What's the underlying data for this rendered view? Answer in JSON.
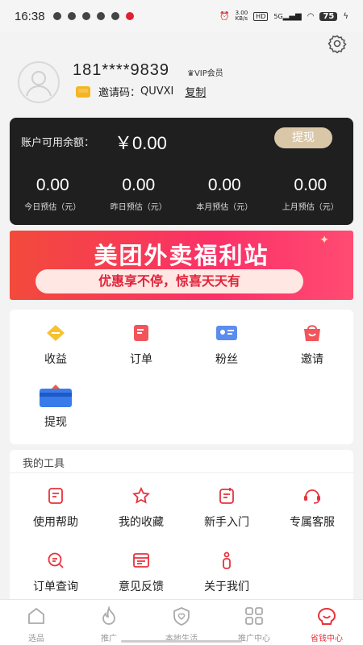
{
  "status_bar": {
    "time": "16:38",
    "net_speed_value": "3.00",
    "net_speed_unit": "KB/s",
    "hd": "HD",
    "sig": "5G",
    "battery": "75"
  },
  "profile": {
    "phone": "181****9839",
    "vip_label": "VIP会员",
    "invite_label": "邀请码：",
    "invite_code": "QUVXI",
    "copy_label": "复制"
  },
  "balance": {
    "label": "账户可用余额：",
    "amount": "￥0.00",
    "withdraw_label": "提现",
    "stats": [
      {
        "value": "0.00",
        "label": "今日预估（元）"
      },
      {
        "value": "0.00",
        "label": "昨日预估（元）"
      },
      {
        "value": "0.00",
        "label": "本月预估（元）"
      },
      {
        "value": "0.00",
        "label": "上月预估（元）"
      }
    ]
  },
  "banner": {
    "title": "美团外卖福利站",
    "subtitle": "优惠享不停，惊喜天天有"
  },
  "grid": [
    {
      "label": "收益",
      "icon": "earnings-icon"
    },
    {
      "label": "订单",
      "icon": "order-icon"
    },
    {
      "label": "粉丝",
      "icon": "fans-icon"
    },
    {
      "label": "邀请",
      "icon": "invite-icon"
    },
    {
      "label": "提现",
      "icon": "withdraw-icon"
    }
  ],
  "tools": {
    "title": "我的工具",
    "items": [
      {
        "label": "使用帮助",
        "icon": "help-icon"
      },
      {
        "label": "我的收藏",
        "icon": "favorite-icon"
      },
      {
        "label": "新手入门",
        "icon": "beginner-icon"
      },
      {
        "label": "专属客服",
        "icon": "customer-service-icon"
      },
      {
        "label": "订单查询",
        "icon": "order-search-icon"
      },
      {
        "label": "意见反馈",
        "icon": "feedback-icon"
      },
      {
        "label": "关于我们",
        "icon": "about-icon"
      }
    ]
  },
  "tabbar": [
    {
      "label": "选品",
      "icon": "home-icon"
    },
    {
      "label": "推广",
      "icon": "fire-icon"
    },
    {
      "label": "本地生活",
      "icon": "shield-heart-icon"
    },
    {
      "label": "推广中心",
      "icon": "grid-icon"
    },
    {
      "label": "省钱中心",
      "icon": "smile-bag-icon",
      "active": true
    }
  ],
  "colors": {
    "accent": "#e8323c",
    "card_dark": "#1f1f1f",
    "gold_button": "#d9c7a8"
  }
}
